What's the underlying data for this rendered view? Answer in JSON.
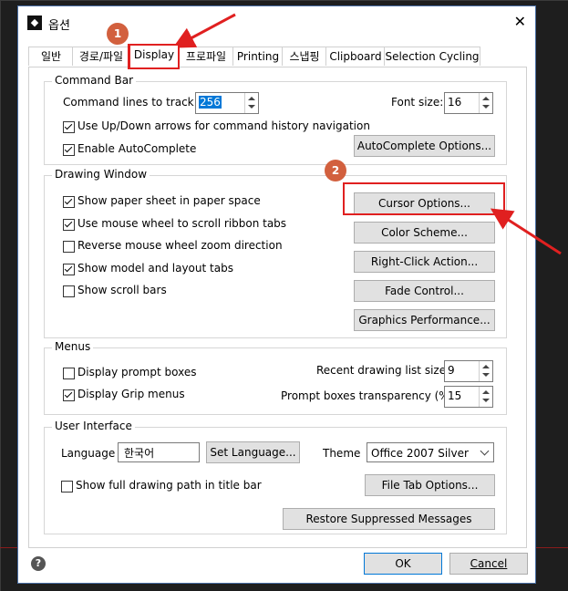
{
  "window": {
    "title": "옵션",
    "close_glyph": "✕"
  },
  "tabs": [
    {
      "label": "일반"
    },
    {
      "label": "경로/파일"
    },
    {
      "label": "Display"
    },
    {
      "label": "프로파일"
    },
    {
      "label": "Printing"
    },
    {
      "label": "스냅핑"
    },
    {
      "label": "Clipboard"
    },
    {
      "label": "Selection Cycling"
    }
  ],
  "active_tab": "Display",
  "command_bar": {
    "title": "Command Bar",
    "lines_label": "Command lines to track:",
    "lines_value": "256",
    "font_size_label": "Font size:",
    "font_size_value": "16",
    "updown_label": "Use Up/Down arrows for command history navigation",
    "autocomplete_label": "Enable AutoComplete",
    "autocomplete_options_button": "AutoComplete Options..."
  },
  "drawing_window": {
    "title": "Drawing Window",
    "checks": [
      {
        "label": "Show paper sheet in paper space",
        "checked": true
      },
      {
        "label": "Use mouse wheel to scroll ribbon tabs",
        "checked": true
      },
      {
        "label": "Reverse mouse wheel zoom direction",
        "checked": false
      },
      {
        "label": "Show model and layout tabs",
        "checked": true
      },
      {
        "label": "Show scroll bars",
        "checked": false
      }
    ],
    "buttons": {
      "cursor": "Cursor Options...",
      "color": "Color Scheme...",
      "right_click": "Right-Click Action...",
      "fade": "Fade Control...",
      "graphics": "Graphics Performance..."
    }
  },
  "menus": {
    "title": "Menus",
    "prompt_boxes_label": "Display prompt boxes",
    "grip_menus_label": "Display Grip menus",
    "recent_list_label": "Recent drawing list size:",
    "recent_list_value": "9",
    "transparency_label": "Prompt boxes transparency (%):",
    "transparency_value": "15"
  },
  "user_interface": {
    "title": "User Interface",
    "language_label": "Language",
    "language_value": "한국어",
    "set_language_button": "Set Language...",
    "theme_label": "Theme",
    "theme_value": "Office 2007 Silver",
    "full_path_label": "Show full drawing path in title bar",
    "file_tab_button": "File Tab Options...",
    "restore_button": "Restore Suppressed Messages"
  },
  "footer": {
    "help_glyph": "?",
    "ok": "OK",
    "cancel": "Cancel"
  },
  "annotations": {
    "badge1": "1",
    "badge2": "2",
    "accent": "#e02020"
  }
}
